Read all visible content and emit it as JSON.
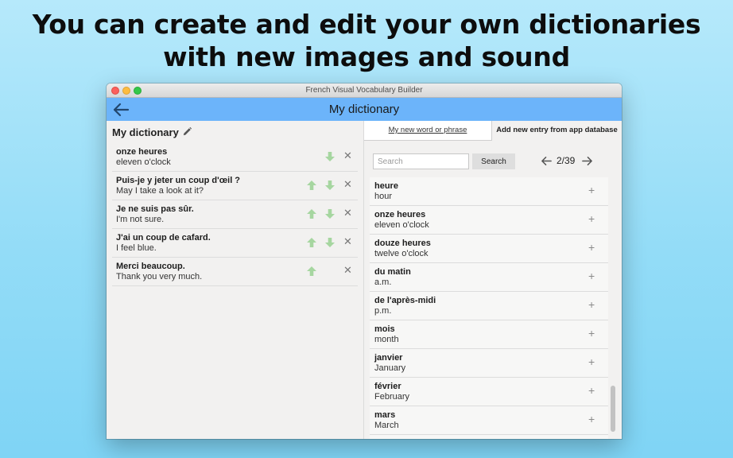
{
  "headline": {
    "line1": "You can create and edit your own dictionaries",
    "line2": "with new images and sound"
  },
  "window": {
    "title": "French Visual Vocabulary Builder"
  },
  "appbar": {
    "title": "My dictionary"
  },
  "left_panel": {
    "title": "My dictionary",
    "entries": [
      {
        "word": "onze heures",
        "translation": "eleven o'clock",
        "up": false,
        "down": true
      },
      {
        "word": "Puis-je y jeter un coup d'œil ?",
        "translation": "May I take a look at it?",
        "up": true,
        "down": true
      },
      {
        "word": "Je ne suis pas sûr.",
        "translation": "I'm not sure.",
        "up": true,
        "down": true
      },
      {
        "word": "J'ai un coup de cafard.",
        "translation": "I feel blue.",
        "up": true,
        "down": true
      },
      {
        "word": "Merci beaucoup.",
        "translation": "Thank you very much.",
        "up": true,
        "down": false
      }
    ]
  },
  "right_panel": {
    "tabs": [
      {
        "label": "My new word or phrase"
      },
      {
        "label": "Add new entry from app database"
      }
    ],
    "search": {
      "placeholder": "Search",
      "value": "",
      "button_label": "Search"
    },
    "pagination": {
      "text": "2/39"
    },
    "results": [
      {
        "word": "heure",
        "translation": "hour"
      },
      {
        "word": "onze heures",
        "translation": "eleven o'clock"
      },
      {
        "word": "douze heures",
        "translation": "twelve o'clock"
      },
      {
        "word": "du matin",
        "translation": "a.m."
      },
      {
        "word": "de l'après-midi",
        "translation": "p.m."
      },
      {
        "word": "mois",
        "translation": "month"
      },
      {
        "word": "janvier",
        "translation": "January"
      },
      {
        "word": "février",
        "translation": "February"
      },
      {
        "word": "mars",
        "translation": "March"
      }
    ]
  },
  "colors": {
    "appbar": "#6cb4fa",
    "arrow_green": "#a6d6a0",
    "background": "#93dcf7"
  }
}
